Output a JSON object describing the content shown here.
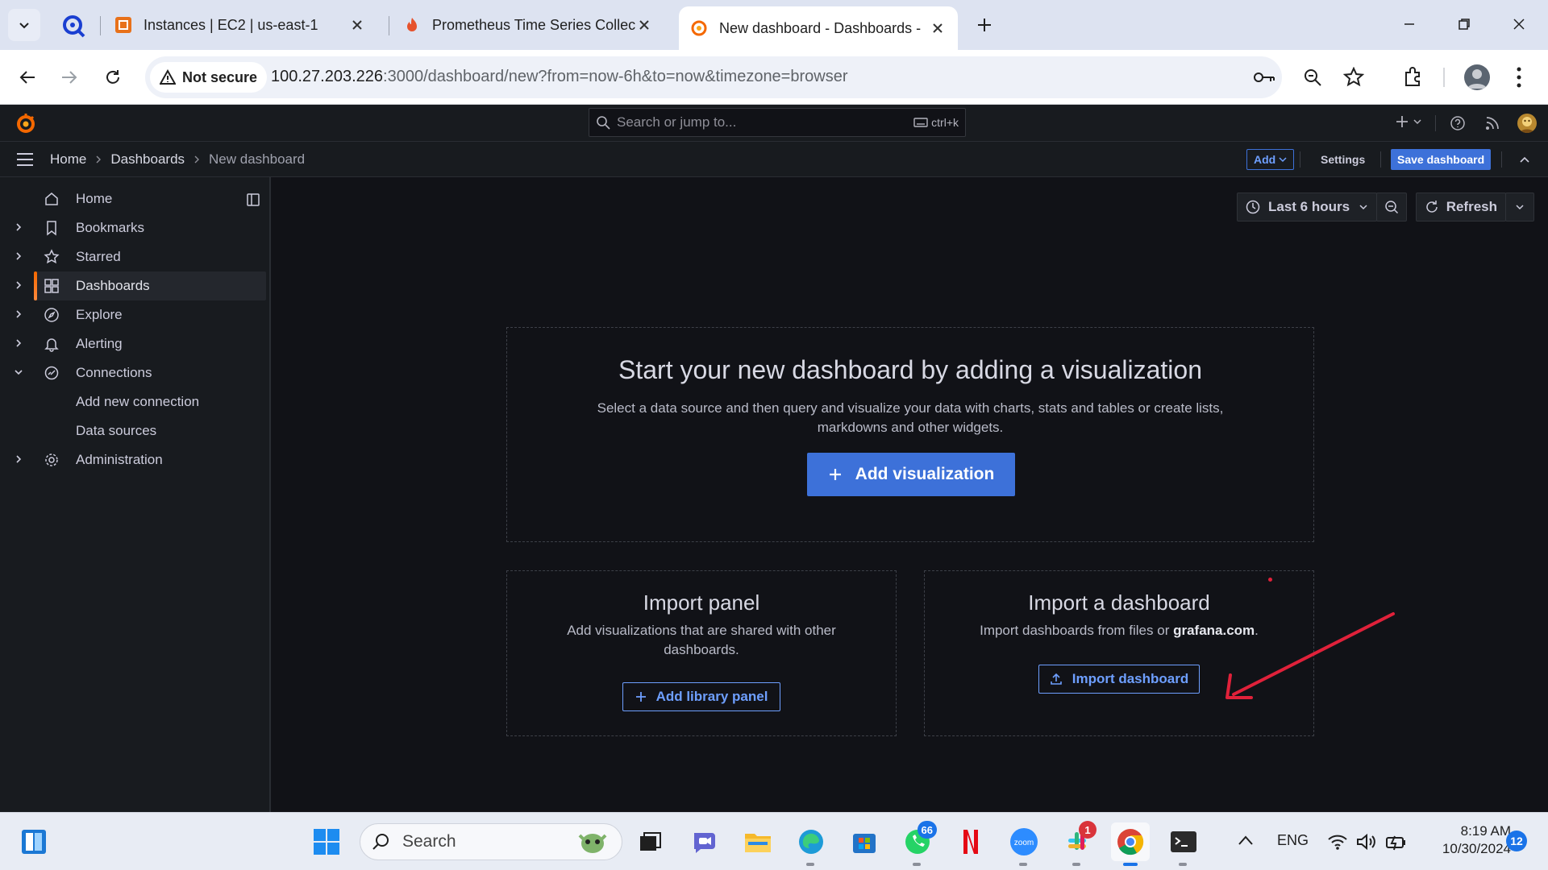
{
  "browser": {
    "tabs": [
      {
        "title": "Instances | EC2 | us-east-1",
        "icon": "aws-icon"
      },
      {
        "title": "Prometheus Time Series Collect",
        "icon": "prometheus-icon"
      },
      {
        "title": "New dashboard - Dashboards -",
        "icon": "grafana-icon",
        "active": true
      }
    ],
    "security_label": "Not secure",
    "url_host": "100.27.203.226",
    "url_rest": ":3000/dashboard/new?from=now-6h&to=now&timezone=browser"
  },
  "grafana": {
    "search_placeholder": "Search or jump to...",
    "search_shortcut": "ctrl+k",
    "breadcrumb": [
      "Home",
      "Dashboards",
      "New dashboard"
    ],
    "toolbar": {
      "add_label": "Add",
      "settings_label": "Settings",
      "save_label": "Save dashboard"
    },
    "sidebar": {
      "items": [
        {
          "label": "Home",
          "icon": "home-icon"
        },
        {
          "label": "Bookmarks",
          "icon": "bookmark-icon"
        },
        {
          "label": "Starred",
          "icon": "star-icon"
        },
        {
          "label": "Dashboards",
          "icon": "dashboards-icon",
          "active": true
        },
        {
          "label": "Explore",
          "icon": "compass-icon"
        },
        {
          "label": "Alerting",
          "icon": "bell-icon"
        },
        {
          "label": "Connections",
          "icon": "connections-icon",
          "expanded": true
        },
        {
          "label": "Add new connection",
          "sub": true
        },
        {
          "label": "Data sources",
          "sub": true
        },
        {
          "label": "Administration",
          "icon": "gear-icon"
        }
      ]
    },
    "time_picker": {
      "range": "Last 6 hours",
      "refresh_label": "Refresh"
    },
    "empty_state": {
      "title": "Start your new dashboard by adding a visualization",
      "subtitle_line1": "Select a data source and then query and visualize your data with charts, stats and tables or create lists,",
      "subtitle_line2": "markdowns and other widgets.",
      "add_visualization": "Add visualization"
    },
    "import_panel": {
      "title": "Import panel",
      "desc_line1": "Add visualizations that are shared with other",
      "desc_line2": "dashboards.",
      "button": "Add library panel"
    },
    "import_dashboard": {
      "title": "Import a dashboard",
      "desc_prefix": "Import dashboards from files or ",
      "desc_link": "grafana.com",
      "desc_suffix": ".",
      "button": "Import dashboard"
    }
  },
  "taskbar": {
    "search_label": "Search",
    "whatsapp_badge": "66",
    "slack_badge": "1",
    "language": "ENG",
    "time": "8:19 AM",
    "date": "10/30/2024",
    "notification_count": "12"
  },
  "colors": {
    "accent": "#3d71d9",
    "grafana_orange": "#f46800",
    "annotation_red": "#e0213a"
  }
}
